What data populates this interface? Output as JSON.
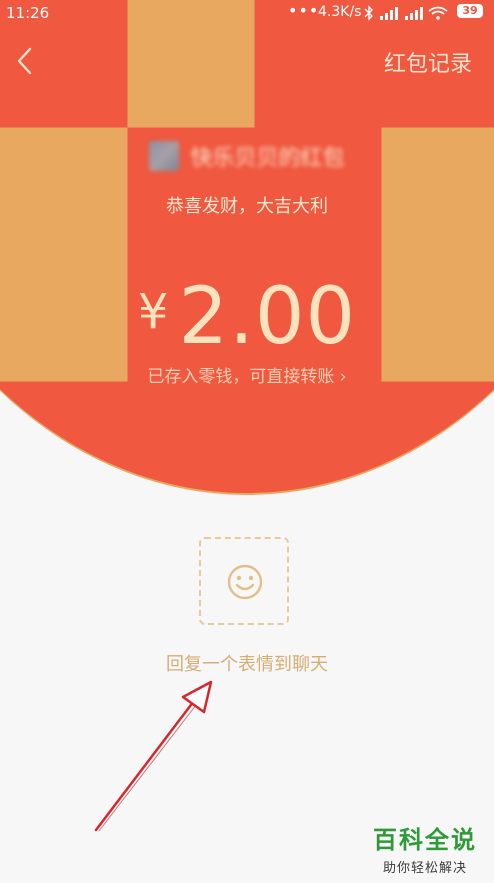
{
  "status_bar": {
    "time": "11:26",
    "dots": "•••",
    "network_speed": "4.3K/s",
    "battery_level": "39"
  },
  "header": {
    "records_label": "红包记录"
  },
  "packet": {
    "sender_name": "快乐贝贝的红包",
    "greeting": "恭喜发财，大吉大利",
    "currency_symbol": "¥",
    "amount": "2.00",
    "saved_note": "已存入零钱，可直接转账 ›"
  },
  "reply": {
    "label": "回复一个表情到聊天"
  },
  "watermark": {
    "title": "百科全说",
    "subtitle": "助你轻松解决"
  },
  "colors": {
    "header_red": "#f0583f",
    "amount_gold": "#fde3bd",
    "reply_gold": "#d7ad74",
    "annotation_arrow": "#d8262d",
    "watermark_green": "#2f9a3a"
  },
  "icons": {
    "back": "chevron-left-icon",
    "emoji": "smiley-face-icon",
    "bluetooth": "bluetooth-icon",
    "signal": "signal-bars-icon",
    "wifi": "wifi-icon"
  }
}
